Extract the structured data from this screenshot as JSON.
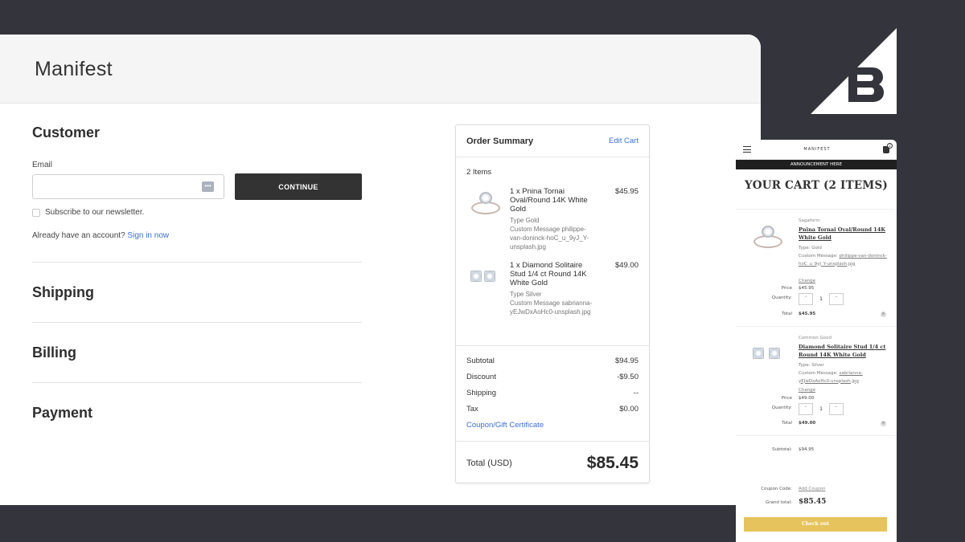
{
  "store": {
    "name": "Manifest"
  },
  "checkout": {
    "customer_title": "Customer",
    "email_label": "Email",
    "email_value": "",
    "continue_label": "CONTINUE",
    "subscribe_label": "Subscribe to our newsletter.",
    "account_prompt": "Already have an account?",
    "sign_in_label": "Sign in now",
    "steps": [
      "Shipping",
      "Billing",
      "Payment"
    ]
  },
  "summary": {
    "title": "Order Summary",
    "edit_cart": "Edit Cart",
    "items_count": "2 Items",
    "items": [
      {
        "name": "1 x Pnina Tornai Oval/Round 14K White Gold",
        "type": "Type Gold",
        "custom": "Custom Message philippe-van-doninck-hoC_u_9yJ_Y-unsplash.jpg",
        "price": "$45.95"
      },
      {
        "name": "1 x Diamond Solitaire Stud 1/4 ct Round 14K White Gold",
        "type": "Type Silver",
        "custom": "Custom Message sabrianna-yEJwDxAoHc0-unsplash.jpg",
        "price": "$49.00"
      }
    ],
    "rows": [
      {
        "label": "Subtotal",
        "value": "$94.95"
      },
      {
        "label": "Discount",
        "value": "-$9.50"
      },
      {
        "label": "Shipping",
        "value": "--"
      },
      {
        "label": "Tax",
        "value": "$0.00"
      }
    ],
    "coupon_label": "Coupon/Gift Certificate",
    "total_label": "Total (USD)",
    "total_value": "$85.45"
  },
  "mobile": {
    "brand": "MANIFEST",
    "cart_badge": "2",
    "announcement": "ANNOUNCEMENT HERE",
    "title": "YOUR CART (2 ITEMS)",
    "items": [
      {
        "brand": "Sagaform",
        "name": "Pnina Tornai Oval/Round 14K White Gold",
        "type": "Type: Gold",
        "custom_label": "Custom Message:",
        "custom_value": "philippe-van-doninck-hoC_u_9yJ_Y-unsplash.jpg",
        "change": "Change",
        "price_label": "Price",
        "price": "$45.95",
        "qty_label": "Quantity:",
        "qty": "1",
        "total_label": "Total",
        "total": "$45.95"
      },
      {
        "brand": "Common Good",
        "name": "Diamond Solitaire Stud 1/4 ct Round 14K White Gold",
        "type": "Type: Silver",
        "custom_label": "Custom Message:",
        "custom_value": "sabrianna-yEJwDxAoHc0-unsplash.jpg",
        "change": "Change",
        "price_label": "Price",
        "price": "$49.00",
        "qty_label": "Quantity:",
        "qty": "1",
        "total_label": "Total",
        "total": "$49.00"
      }
    ],
    "subtotal_label": "Subtotal:",
    "subtotal": "$94.95",
    "coupon_label": "Coupon Code:",
    "coupon_link": "Add Coupon",
    "grand_label": "Grand total:",
    "grand_total": "$85.45",
    "checkout_label": "Check out"
  },
  "colors": {
    "background": "#33343c",
    "link": "#3b6fd8",
    "checkout_button": "#e6c35c",
    "dark_button": "#333333"
  }
}
